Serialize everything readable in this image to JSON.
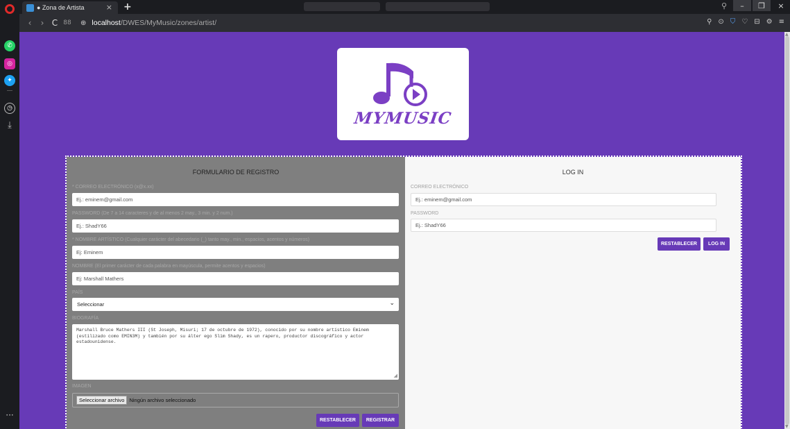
{
  "browser": {
    "tab_title": "● Zona de Artista",
    "tab_close": "×",
    "new_tab": "+",
    "url_host": "localhost",
    "url_path": "/DWES/MyMusic/zones/artist/",
    "nav": {
      "back": "‹",
      "forward": "›",
      "reload": "C",
      "grid": "88"
    },
    "window": {
      "search": "⚲",
      "min": "–",
      "max": "❐",
      "close": "×"
    },
    "toolbar_icons": [
      "⚲",
      "⊙",
      "⛉",
      "♡",
      "⊟",
      "⚙",
      "≡"
    ]
  },
  "sidebar": {
    "icons": [
      "opera-icon",
      "whatsapp-icon",
      "instagram-icon",
      "twitter-icon",
      "history-icon",
      "downloads-icon",
      "more-icon"
    ],
    "download_glyph": "⤓",
    "more_glyph": "···"
  },
  "logo": {
    "text": "MYMUSIC"
  },
  "register": {
    "title": "FORMULARIO DE REGISTRO",
    "email_label": "* CORREO ELECTRÓNICO (x@x.xx)",
    "email_placeholder": "Ej.: eminem@gmail.com",
    "password_label": "PASSWORD (De 7 a 14 caracteres y de al menos 2 may., 3 min. y 2 num.)",
    "password_placeholder": "Ej.: ShadY66",
    "artist_label": "* NOMBRE ARTÍSTICO (Cualquier carácter del abecedario (_) tanto may., min., espacios, acentos y números)",
    "artist_placeholder": "Ej: Eminem",
    "name_label": "NOMBRE (El primer carácter de cada palabra en mayúscula, permite acentos y espacios)",
    "name_placeholder": "Ej: Marshall Mathers",
    "country_label": "PAÍS",
    "country_value": "Seleccionar",
    "bio_label": "BIOGRAFÍA",
    "bio_value": "Marshall Bruce Mathers III (St Joseph, Misuri; 17 de octubre de 1972), conocido por su nombre artístico Eminem (estilizado como EMIN3M) y también por su álter ego Slim Shady, es un rapero, productor discográfico y actor estadounidense.",
    "image_label": "IMAGEN",
    "file_button": "Seleccionar archivo",
    "file_status": "Ningún archivo seleccionado",
    "reset_button": "RESTABLECER",
    "submit_button": "REGISTRAR"
  },
  "login": {
    "title": "LOG IN",
    "email_label": "CORREO ELECTRÓNICO",
    "email_placeholder": "Ej.: eminem@gmail.com",
    "password_label": "PASSWORD",
    "password_placeholder": "Ej.: ShadY66",
    "reset_button": "RESTABLECER",
    "submit_button": "LOG IN"
  },
  "colors": {
    "accent": "#673ab7",
    "form_bg": "#7f7f7f",
    "login_bg": "#f7f7f7"
  }
}
